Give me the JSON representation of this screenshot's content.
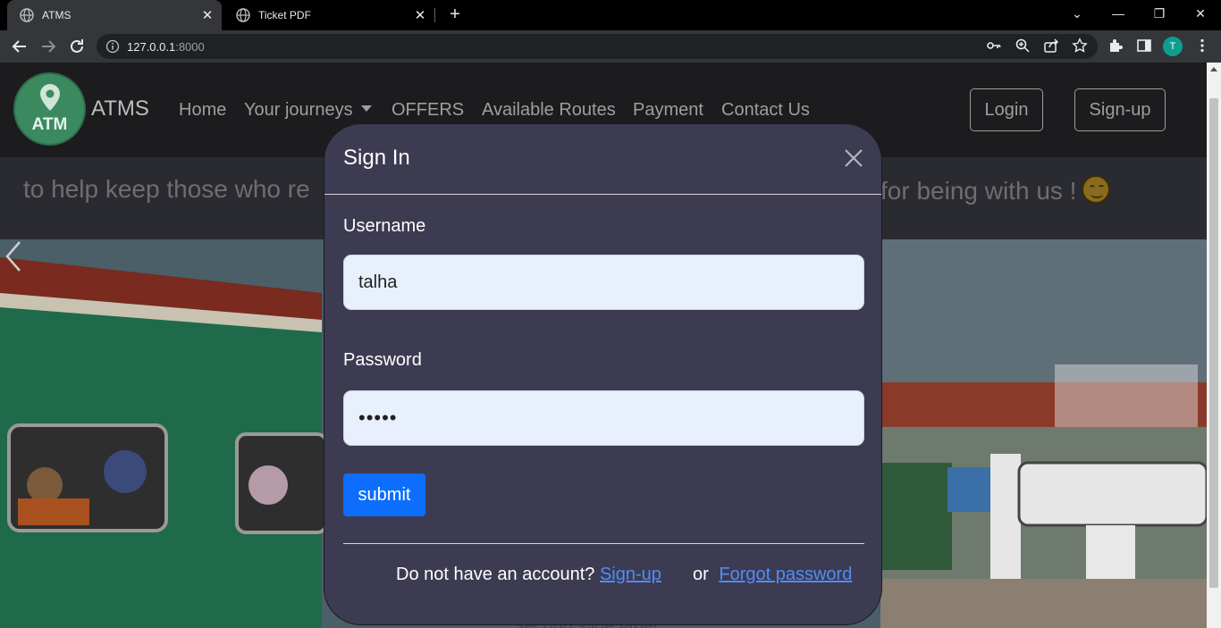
{
  "browser": {
    "tabs": [
      {
        "title": "ATMS",
        "active": true
      },
      {
        "title": "Ticket PDF",
        "active": false
      }
    ],
    "url_host": "127.0.0.1",
    "url_port": ":8000",
    "profile_initial": "T"
  },
  "site": {
    "logo_text": "ATM",
    "brand": "ATMS",
    "nav": {
      "home": "Home",
      "journeys": "Your journeys",
      "offers": "OFFERS",
      "routes": "Available Routes",
      "payment": "Payment",
      "contact": "Contact Us"
    },
    "login_label": "Login",
    "signup_label": "Sign-up",
    "marquee_left": "to help keep those who re",
    "marquee_right": "for being with us !",
    "slide_caption": "Second slide label"
  },
  "modal": {
    "title": "Sign In",
    "username_label": "Username",
    "username_value": "talha",
    "password_label": "Password",
    "password_value": "•••••",
    "submit_label": "submit",
    "footer_text": "Do not have an account?",
    "signup_link": "Sign-up",
    "or_text": "or",
    "forgot_link": "Forgot password"
  },
  "colors": {
    "accent": "#0d6efd",
    "modal_bg": "#3c3b52",
    "link": "#4f8df5"
  }
}
